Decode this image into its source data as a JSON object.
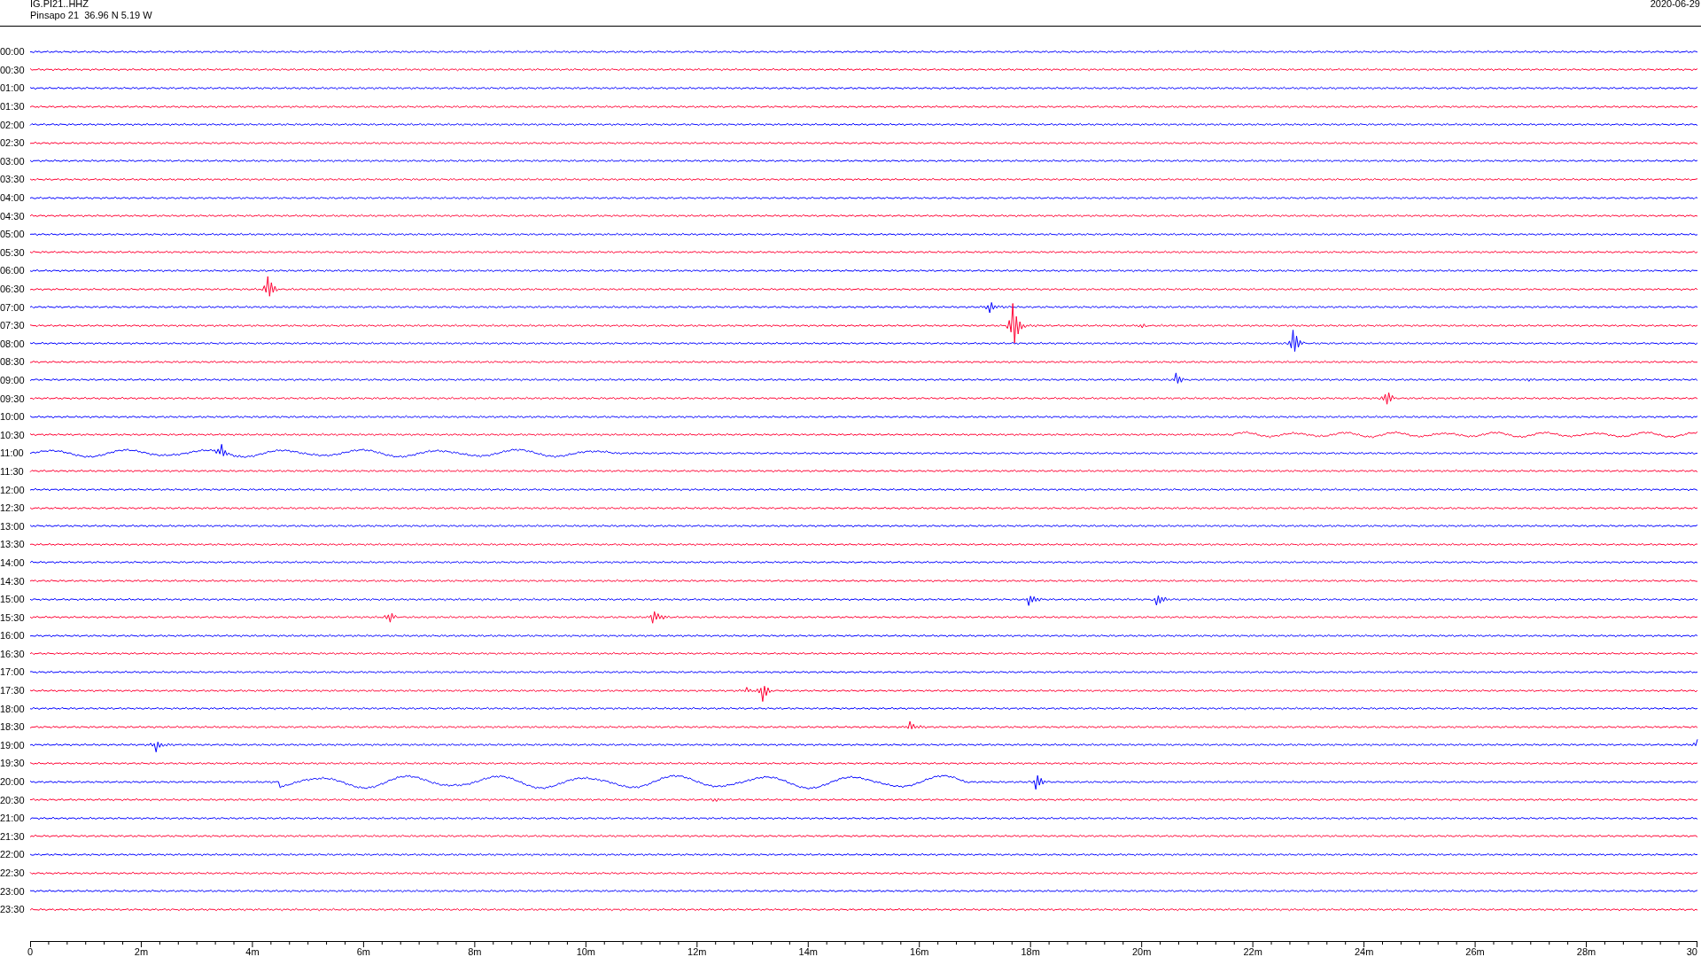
{
  "header": {
    "station": "IG.PI21..HHZ",
    "location": "Pinsapo 21  36.96 N 5.19 W",
    "date": "2020-06-29"
  },
  "rows": [
    {
      "time": "00:00",
      "color": "#0000ff"
    },
    {
      "time": "00:30",
      "color": "#ff0033"
    },
    {
      "time": "01:00",
      "color": "#0000ff"
    },
    {
      "time": "01:30",
      "color": "#ff0033"
    },
    {
      "time": "02:00",
      "color": "#0000ff"
    },
    {
      "time": "02:30",
      "color": "#ff0033"
    },
    {
      "time": "03:00",
      "color": "#0000ff"
    },
    {
      "time": "03:30",
      "color": "#ff0033"
    },
    {
      "time": "04:00",
      "color": "#0000ff"
    },
    {
      "time": "04:30",
      "color": "#ff0033"
    },
    {
      "time": "05:00",
      "color": "#0000ff"
    },
    {
      "time": "05:30",
      "color": "#ff0033"
    },
    {
      "time": "06:00",
      "color": "#0000ff"
    },
    {
      "time": "06:30",
      "color": "#ff0033"
    },
    {
      "time": "07:00",
      "color": "#0000ff"
    },
    {
      "time": "07:30",
      "color": "#ff0033"
    },
    {
      "time": "08:00",
      "color": "#0000ff"
    },
    {
      "time": "08:30",
      "color": "#ff0033"
    },
    {
      "time": "09:00",
      "color": "#0000ff"
    },
    {
      "time": "09:30",
      "color": "#ff0033"
    },
    {
      "time": "10:00",
      "color": "#0000ff"
    },
    {
      "time": "10:30",
      "color": "#ff0033"
    },
    {
      "time": "11:00",
      "color": "#0000ff"
    },
    {
      "time": "11:30",
      "color": "#ff0033"
    },
    {
      "time": "12:00",
      "color": "#0000ff"
    },
    {
      "time": "12:30",
      "color": "#ff0033"
    },
    {
      "time": "13:00",
      "color": "#0000ff"
    },
    {
      "time": "13:30",
      "color": "#ff0033"
    },
    {
      "time": "14:00",
      "color": "#0000ff"
    },
    {
      "time": "14:30",
      "color": "#ff0033"
    },
    {
      "time": "15:00",
      "color": "#0000ff"
    },
    {
      "time": "15:30",
      "color": "#ff0033"
    },
    {
      "time": "16:00",
      "color": "#0000ff"
    },
    {
      "time": "16:30",
      "color": "#ff0033"
    },
    {
      "time": "17:00",
      "color": "#0000ff"
    },
    {
      "time": "17:30",
      "color": "#ff0033"
    },
    {
      "time": "18:00",
      "color": "#0000ff"
    },
    {
      "time": "18:30",
      "color": "#ff0033"
    },
    {
      "time": "19:00",
      "color": "#0000ff"
    },
    {
      "time": "19:30",
      "color": "#ff0033"
    },
    {
      "time": "20:00",
      "color": "#0000ff"
    },
    {
      "time": "20:30",
      "color": "#ff0033"
    },
    {
      "time": "21:00",
      "color": "#0000ff"
    },
    {
      "time": "21:30",
      "color": "#ff0033"
    },
    {
      "time": "22:00",
      "color": "#0000ff"
    },
    {
      "time": "22:30",
      "color": "#ff0033"
    },
    {
      "time": "23:00",
      "color": "#0000ff"
    },
    {
      "time": "23:30",
      "color": "#ff0033"
    }
  ],
  "x_axis": {
    "labels": [
      "0",
      "2m",
      "4m",
      "6m",
      "8m",
      "10m",
      "12m",
      "14m",
      "16m",
      "18m",
      "20m",
      "22m",
      "24m",
      "26m",
      "28m",
      "30"
    ]
  }
}
